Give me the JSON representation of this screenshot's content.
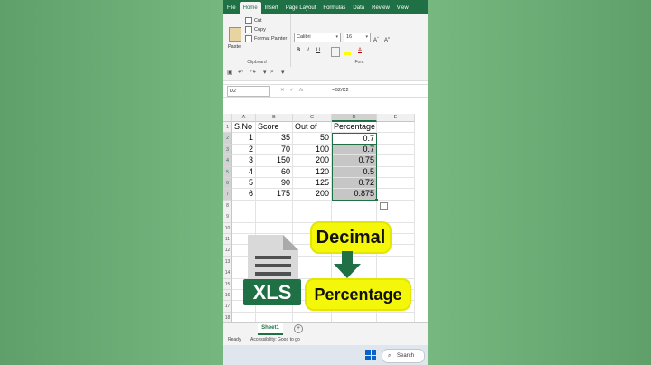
{
  "colors": {
    "excel_green": "#1f7145",
    "pill_yellow": "#f4f70a",
    "background": "#6aac74"
  },
  "ribbon_tabs": [
    {
      "label": "File",
      "active": false
    },
    {
      "label": "Home",
      "active": true
    },
    {
      "label": "Insert",
      "active": false
    },
    {
      "label": "Page Layout",
      "active": false
    },
    {
      "label": "Formulas",
      "active": false
    },
    {
      "label": "Data",
      "active": false
    },
    {
      "label": "Review",
      "active": false
    },
    {
      "label": "View",
      "active": false
    }
  ],
  "clipboard": {
    "paste_label": "Paste",
    "cut_label": "Cut",
    "copy_label": "Copy",
    "format_painter_label": "Format Painter",
    "group_label": "Clipboard"
  },
  "font": {
    "family": "Calibri",
    "size": "16",
    "group_label": "Font",
    "bold": "B",
    "italic": "I",
    "underline": "U"
  },
  "formula_bar": {
    "name_box": "D2",
    "cancel_icon": "✕",
    "enter_icon": "✓",
    "fx_label": "fx",
    "formula": "=B2/C2"
  },
  "grid": {
    "columns": [
      "A",
      "B",
      "C",
      "D",
      "E"
    ],
    "rows": [
      {
        "n": "1",
        "cells": [
          "S.No",
          "Score",
          "Out of",
          "Percentage",
          ""
        ]
      },
      {
        "n": "2",
        "cells": [
          "1",
          "35",
          "50",
          "0.7",
          ""
        ]
      },
      {
        "n": "3",
        "cells": [
          "2",
          "70",
          "100",
          "0.7",
          ""
        ]
      },
      {
        "n": "4",
        "cells": [
          "3",
          "150",
          "200",
          "0.75",
          ""
        ]
      },
      {
        "n": "5",
        "cells": [
          "4",
          "60",
          "120",
          "0.5",
          ""
        ]
      },
      {
        "n": "6",
        "cells": [
          "5",
          "90",
          "125",
          "0.72",
          ""
        ]
      },
      {
        "n": "7",
        "cells": [
          "6",
          "175",
          "200",
          "0.875",
          ""
        ]
      },
      {
        "n": "8",
        "cells": [
          "",
          "",
          "",
          "",
          ""
        ]
      },
      {
        "n": "9",
        "cells": [
          "",
          "",
          "",
          "",
          ""
        ]
      },
      {
        "n": "10",
        "cells": [
          "",
          "",
          "",
          "",
          ""
        ]
      },
      {
        "n": "11",
        "cells": [
          "",
          "",
          "",
          "",
          ""
        ]
      },
      {
        "n": "12",
        "cells": [
          "",
          "",
          "",
          "",
          ""
        ]
      },
      {
        "n": "13",
        "cells": [
          "",
          "",
          "",
          "",
          ""
        ]
      },
      {
        "n": "14",
        "cells": [
          "",
          "",
          "",
          "",
          ""
        ]
      },
      {
        "n": "15",
        "cells": [
          "",
          "",
          "",
          "",
          ""
        ]
      },
      {
        "n": "16",
        "cells": [
          "",
          "",
          "",
          "",
          ""
        ]
      },
      {
        "n": "17",
        "cells": [
          "",
          "",
          "",
          "",
          ""
        ]
      },
      {
        "n": "18",
        "cells": [
          "",
          "",
          "",
          "",
          ""
        ]
      }
    ],
    "selected_column": "D"
  },
  "sheet_tabs": {
    "active": "Sheet1",
    "add_label": "+"
  },
  "status": {
    "ready": "Ready",
    "accessibility": "Accessibility: Good to go"
  },
  "taskbar": {
    "search_label": "Search"
  },
  "overlay": {
    "xls_label": "XLS",
    "decimal_label": "Decimal",
    "percentage_label": "Percentage"
  }
}
